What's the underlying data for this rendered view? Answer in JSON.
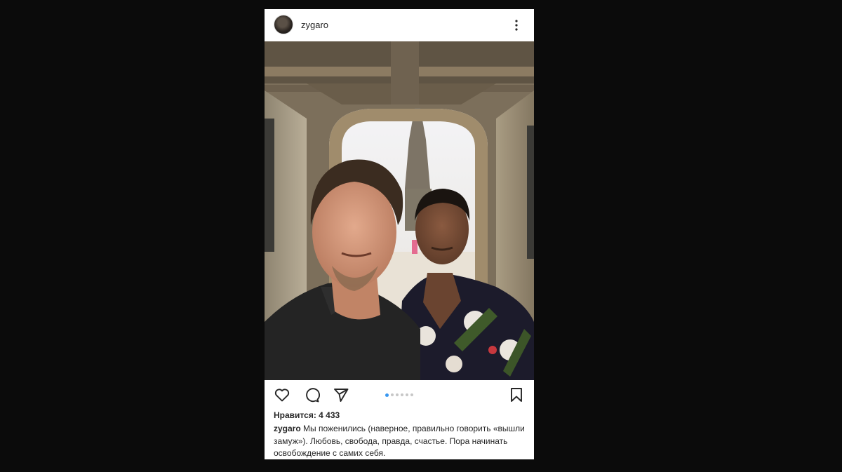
{
  "post": {
    "username": "zygaro",
    "likes_text": "Нравится: 4 433",
    "caption_user": "zygaro",
    "caption_text": "Мы поженились (наверное, правильно говорить «вышли замуж»). Любовь, свобода, правда, счастье. Пора начинать освобождение с самих себя.",
    "carousel": {
      "total": 6,
      "active": 1
    }
  },
  "icons": {
    "more": "more-vertical-icon",
    "like": "heart-icon",
    "comment": "comment-bubble-icon",
    "share": "paper-plane-icon",
    "save": "bookmark-icon"
  },
  "colors": {
    "background": "#0b0b0b",
    "card": "#ffffff",
    "text": "#262626",
    "carousel_active": "#3897f0",
    "carousel_inactive": "#c7c7c7"
  }
}
